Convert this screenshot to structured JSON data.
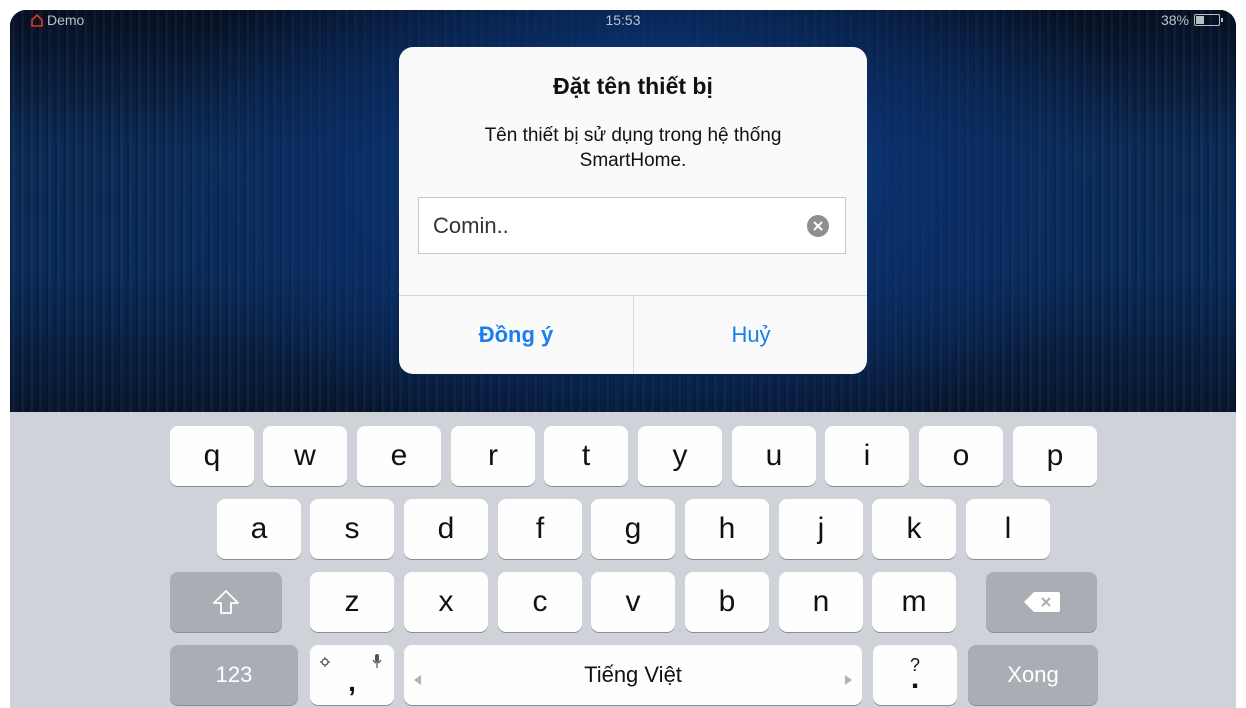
{
  "status_bar": {
    "carrier": "Demo",
    "time": "15:53",
    "battery": "38%",
    "battery_level": 0.38
  },
  "dialog": {
    "title": "Đặt tên thiết bị",
    "message_line1": "Tên thiết bị sử dụng trong hệ thống",
    "message_line2": "SmartHome.",
    "input_value": "Comin..",
    "ok_label": "Đồng ý",
    "cancel_label": "Huỷ"
  },
  "keyboard": {
    "row1": [
      "q",
      "w",
      "e",
      "r",
      "t",
      "y",
      "u",
      "i",
      "o",
      "p"
    ],
    "row2": [
      "a",
      "s",
      "d",
      "f",
      "g",
      "h",
      "j",
      "k",
      "l"
    ],
    "row3": [
      "z",
      "x",
      "c",
      "v",
      "b",
      "n",
      "m"
    ],
    "numbers_label": "123",
    "comma_label": ",",
    "space_label": "Tiếng Việt",
    "period_label": ".",
    "question_label": "?",
    "done_label": "Xong"
  },
  "colors": {
    "accent": "#1a7ef0",
    "keyboard_bg": "#cfd3d9",
    "dark_key": "#a9aeb5"
  }
}
